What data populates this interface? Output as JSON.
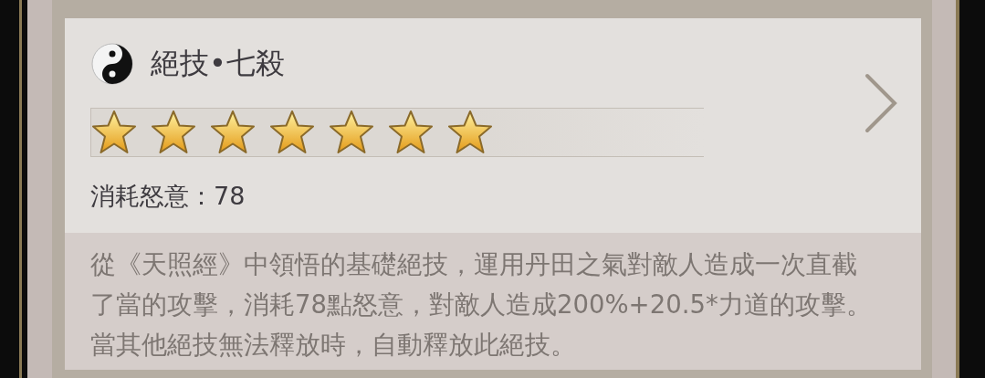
{
  "skill": {
    "title": "絕技•七殺",
    "stars": 7,
    "cost": "消耗怒意：78",
    "description": "從《天照經》中領悟的基礎絕技，運用丹田之氣對敵人造成一次直截了當的攻擊，消耗78點怒意，對敵人造成200%+20.5*力道的攻擊。當其他絕技無法釋放時，自動釋放此絕技。"
  }
}
